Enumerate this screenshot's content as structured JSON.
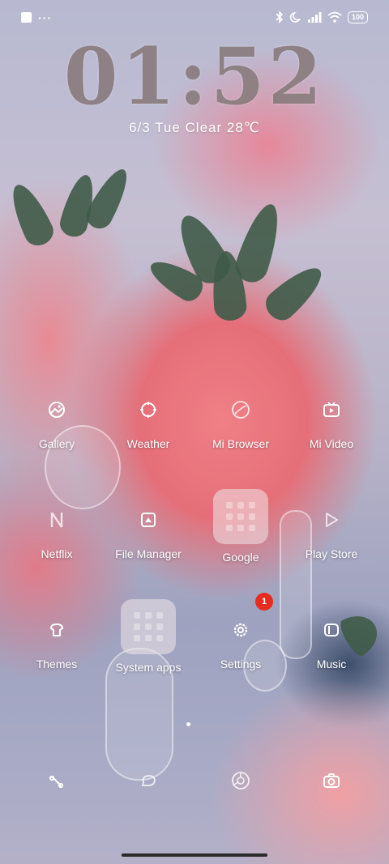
{
  "status_bar": {
    "battery": "100",
    "icons": [
      "square-icon",
      "more-dots-icon",
      "bluetooth-icon",
      "moon-icon",
      "signal-icon",
      "wifi-icon",
      "battery-icon"
    ]
  },
  "lockscreen": {
    "time": "01:52",
    "date_weather": "6/3  Tue  Clear  28℃"
  },
  "apps": {
    "gallery": "Gallery",
    "weather": "Weather",
    "mi_browser": "Mi Browser",
    "mi_video": "Mi Video",
    "netflix": "Netflix",
    "file_manager": "File Manager",
    "google": "Google",
    "play_store": "Play Store",
    "themes": "Themes",
    "system_apps": "System apps",
    "settings": "Settings",
    "music": "Music"
  },
  "badges": {
    "settings": "1"
  },
  "dock": {
    "icons": [
      "phone-icon",
      "messages-icon",
      "browser-icon",
      "camera-icon"
    ]
  },
  "colors": {
    "badge": "#e52c20",
    "icon": "#ffffff"
  }
}
